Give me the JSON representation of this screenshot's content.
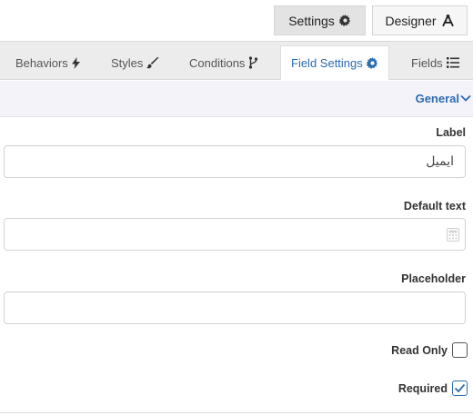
{
  "top_buttons": {
    "settings_label": "Settings",
    "designer_label": "Designer"
  },
  "tabs": [
    {
      "label": "Behaviors",
      "icon": "bolt-icon"
    },
    {
      "label": "Styles",
      "icon": "brush-icon"
    },
    {
      "label": "Conditions",
      "icon": "branch-icon"
    },
    {
      "label": "Field Settings",
      "icon": "gear-icon",
      "active": true
    },
    {
      "label": "Fields",
      "icon": "list-icon"
    }
  ],
  "section": {
    "title": "General"
  },
  "fields": {
    "label": {
      "caption": "Label",
      "value": "ایمیل"
    },
    "default_text": {
      "caption": "Default text",
      "value": ""
    },
    "placeholder": {
      "caption": "Placeholder",
      "value": ""
    }
  },
  "checks": {
    "read_only": {
      "caption": "Read Only",
      "checked": false
    },
    "required": {
      "caption": "Required",
      "checked": true
    }
  },
  "colors": {
    "accent": "#2b6cb0",
    "tab_bar": "#ececec",
    "section_bg": "#f4f3fa"
  }
}
